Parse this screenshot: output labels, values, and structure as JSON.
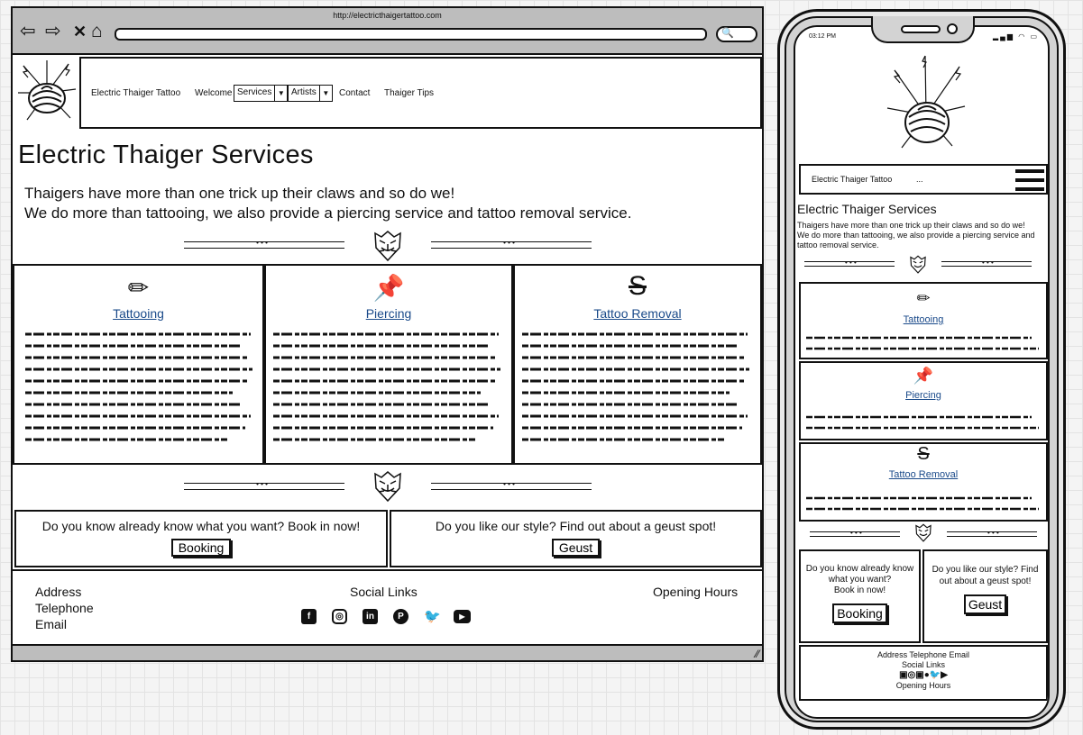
{
  "browser": {
    "url": "http://electricthaigertattoo.com",
    "nav_icons": [
      "back-arrow-icon",
      "forward-arrow-icon",
      "close-icon",
      "home-icon"
    ]
  },
  "site": {
    "brand": "Electric Thaiger Tattoo",
    "nav": {
      "welcome": "Welcome",
      "services": "Services",
      "artists": "Artists",
      "contact": "Contact",
      "tips": "Thaiger Tips"
    },
    "title": "Electric Thaiger Services",
    "intro_line1": "Thaigers have more than one trick up their claws and so do we!",
    "intro_line2": "We do more than tattooing, we also provide a piercing service and tattoo removal service.",
    "intro_full": "Thaigers have more than one trick up their claws and so do we! We do more than tattooing, we also provide a piercing service and tattoo removal service.",
    "services": [
      {
        "name": "Tattooing",
        "icon": "pencil-icon"
      },
      {
        "name": "Piercing",
        "icon": "pushpin-icon"
      },
      {
        "name": "Tattoo Removal",
        "icon": "strikethrough-icon"
      }
    ],
    "booking": {
      "prompt": "Do you know already know what you want? Book in now!",
      "prompt_mobile_1": "Do you know already know what you want?",
      "prompt_mobile_2": "Book in now!",
      "button": "Booking"
    },
    "guest": {
      "prompt": "Do you like our style? Find out about a geust spot!",
      "button": "Geust"
    },
    "footer": {
      "address": "Address",
      "telephone": "Telephone",
      "email": "Email",
      "contact_mobile": "Address Telephone Email",
      "social": "Social Links",
      "hours": "Opening Hours",
      "social_icons": [
        "facebook-icon",
        "instagram-icon",
        "linkedin-icon",
        "pinterest-icon",
        "twitter-icon",
        "youtube-icon"
      ]
    }
  },
  "mobile": {
    "time": "03:12 PM",
    "brand": "Electric Thaiger Tattoo",
    "ellipsis": "..."
  }
}
